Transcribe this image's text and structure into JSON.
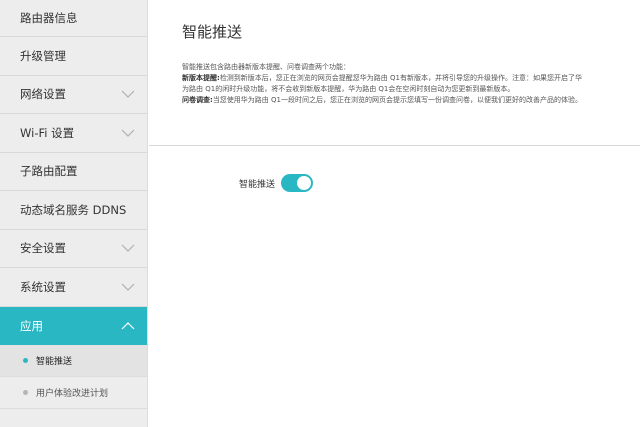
{
  "sidebar": {
    "items": [
      {
        "label": "路由器信息"
      },
      {
        "label": "升级管理"
      },
      {
        "label": "网络设置"
      },
      {
        "label": "Wi-Fi 设置"
      },
      {
        "label": "子路由配置"
      },
      {
        "label": "动态域名服务 DDNS"
      },
      {
        "label": "安全设置"
      },
      {
        "label": "系统设置"
      },
      {
        "label": "应用"
      }
    ],
    "sub_items": [
      {
        "label": "智能推送"
      },
      {
        "label": "用户体验改进计划"
      }
    ]
  },
  "main": {
    "title": "智能推送",
    "intro": "智能推送包含路由器新版本提醒、问卷调查两个功能：",
    "new_version_heading": "新版本提醒:",
    "new_version_text": "检测到新版本后，您正在浏览的网页会提醒您华为路由 Q1有新版本，并将引导您的升级操作。注意：如果您开启了华为路由 Q1的闲时升级功能，将不会收到新版本提醒，华为路由 Q1会在空闲时刻自动为您更新到最新版本。",
    "survey_heading": "问卷调查:",
    "survey_text": "当您使用华为路由 Q1一段时间之后，您正在浏览的网页会提示您填写一份调查问卷，以便我们更好的改善产品的体验。",
    "toggle_label": "智能推送",
    "toggle_on": true
  },
  "colors": {
    "accent": "#2ab7c4"
  }
}
